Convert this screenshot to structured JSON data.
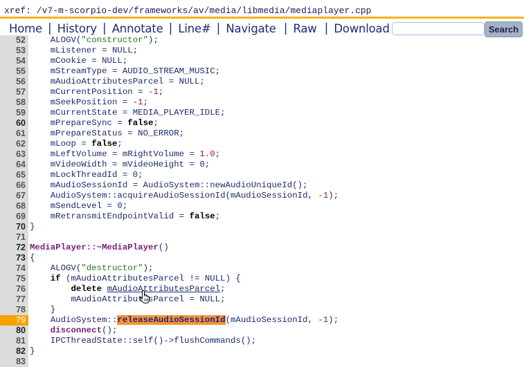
{
  "header": {
    "xref_path": "xref: /v7-m-scorpio-dev/frameworks/av/media/libmedia/mediaplayer.cpp",
    "accent_color": "#f5b21b"
  },
  "nav": {
    "items": [
      {
        "label": "Home"
      },
      {
        "label": "History"
      },
      {
        "label": "Annotate"
      },
      {
        "label": "Line#"
      },
      {
        "label": "Navigate"
      },
      {
        "label": "Raw"
      },
      {
        "label": "Download"
      }
    ],
    "separator": "|",
    "search": {
      "value": "",
      "placeholder": "",
      "button_label": "Search"
    }
  },
  "code": {
    "highlight_line": 79,
    "highlight_color": "#f5a300",
    "lines": [
      {
        "n": "52",
        "tokens": [
          {
            "t": "    ALOGV(",
            "c": ""
          },
          {
            "t": "\"constructor\"",
            "c": "str"
          },
          {
            "t": ");",
            "c": ""
          }
        ]
      },
      {
        "n": "53",
        "tokens": [
          {
            "t": "    mListener = NULL;",
            "c": ""
          }
        ]
      },
      {
        "n": "54",
        "tokens": [
          {
            "t": "    mCookie = NULL;",
            "c": ""
          }
        ]
      },
      {
        "n": "55",
        "tokens": [
          {
            "t": "    mStreamType = AUDIO_STREAM_MUSIC;",
            "c": ""
          }
        ]
      },
      {
        "n": "56",
        "tokens": [
          {
            "t": "    mAudioAttributesParcel = NULL;",
            "c": ""
          }
        ]
      },
      {
        "n": "57",
        "tokens": [
          {
            "t": "    mCurrentPosition = -",
            "c": ""
          },
          {
            "t": "1",
            "c": "num"
          },
          {
            "t": ";",
            "c": ""
          }
        ]
      },
      {
        "n": "58",
        "tokens": [
          {
            "t": "    mSeekPosition = -",
            "c": ""
          },
          {
            "t": "1",
            "c": "num"
          },
          {
            "t": ";",
            "c": ""
          }
        ]
      },
      {
        "n": "59",
        "tokens": [
          {
            "t": "    mCurrentState = MEDIA_PLAYER_IDLE;",
            "c": ""
          }
        ]
      },
      {
        "n": "60",
        "dark": true,
        "tokens": [
          {
            "t": "    mPrepareSync = ",
            "c": ""
          },
          {
            "t": "false",
            "c": "kw"
          },
          {
            "t": ";",
            "c": ""
          }
        ]
      },
      {
        "n": "61",
        "tokens": [
          {
            "t": "    mPrepareStatus = NO_ERROR;",
            "c": ""
          }
        ]
      },
      {
        "n": "62",
        "tokens": [
          {
            "t": "    mLoop = ",
            "c": ""
          },
          {
            "t": "false",
            "c": "kw"
          },
          {
            "t": ";",
            "c": ""
          }
        ]
      },
      {
        "n": "63",
        "tokens": [
          {
            "t": "    mLeftVolume = mRightVolume = ",
            "c": ""
          },
          {
            "t": "1.0",
            "c": "num"
          },
          {
            "t": ";",
            "c": ""
          }
        ]
      },
      {
        "n": "64",
        "tokens": [
          {
            "t": "    mVideoWidth = mVideoHeight = 0;",
            "c": ""
          }
        ]
      },
      {
        "n": "65",
        "tokens": [
          {
            "t": "    mLockThreadId = 0;",
            "c": ""
          }
        ]
      },
      {
        "n": "66",
        "tokens": [
          {
            "t": "    mAudioSessionId = AudioSystem::newAudioUniqueId();",
            "c": ""
          }
        ]
      },
      {
        "n": "67",
        "tokens": [
          {
            "t": "    AudioSystem::acquireAudioSessionId(mAudioSessionId, -",
            "c": ""
          },
          {
            "t": "1",
            "c": "num"
          },
          {
            "t": ");",
            "c": ""
          }
        ]
      },
      {
        "n": "68",
        "tokens": [
          {
            "t": "    mSendLevel = 0;",
            "c": ""
          }
        ]
      },
      {
        "n": "69",
        "tokens": [
          {
            "t": "    mRetransmitEndpointValid = ",
            "c": ""
          },
          {
            "t": "false",
            "c": "kw"
          },
          {
            "t": ";",
            "c": ""
          }
        ]
      },
      {
        "n": "70",
        "dark": true,
        "tokens": [
          {
            "t": "}",
            "c": ""
          }
        ]
      },
      {
        "n": "71",
        "tokens": []
      },
      {
        "n": "72",
        "dark": true,
        "tokens": [
          {
            "t": "MediaPlayer::~MediaPlayer",
            "c": "fn"
          },
          {
            "t": "()",
            "c": ""
          }
        ]
      },
      {
        "n": "73",
        "dark": true,
        "tokens": [
          {
            "t": "{",
            "c": ""
          }
        ]
      },
      {
        "n": "74",
        "tokens": [
          {
            "t": "    ALOGV(",
            "c": ""
          },
          {
            "t": "\"destructor\"",
            "c": "str"
          },
          {
            "t": ");",
            "c": ""
          }
        ]
      },
      {
        "n": "75",
        "tokens": [
          {
            "t": "    ",
            "c": ""
          },
          {
            "t": "if",
            "c": "kw"
          },
          {
            "t": " (mAudioAttributesParcel != NULL) {",
            "c": ""
          }
        ]
      },
      {
        "n": "76",
        "tokens": [
          {
            "t": "        ",
            "c": ""
          },
          {
            "t": "delete",
            "c": "kw"
          },
          {
            "t": " ",
            "c": ""
          },
          {
            "t": "mAudioAttributesParcel",
            "c": "link-u"
          },
          {
            "t": ";",
            "c": ""
          }
        ]
      },
      {
        "n": "77",
        "tokens": [
          {
            "t": "        mAudioAttributesParcel = NULL;",
            "c": ""
          }
        ]
      },
      {
        "n": "78",
        "tokens": [
          {
            "t": "    }",
            "c": ""
          }
        ]
      },
      {
        "n": "79",
        "hl": true,
        "tokens": [
          {
            "t": "    AudioSystem::",
            "c": ""
          },
          {
            "t": "releaseAudioSessionId",
            "c": "hit"
          },
          {
            "t": "(mAudioSessionId, -",
            "c": ""
          },
          {
            "t": "1",
            "c": "num"
          },
          {
            "t": ");",
            "c": ""
          }
        ]
      },
      {
        "n": "80",
        "dark": true,
        "tokens": [
          {
            "t": "    ",
            "c": ""
          },
          {
            "t": "disconnect",
            "c": "fn"
          },
          {
            "t": "();",
            "c": ""
          }
        ]
      },
      {
        "n": "81",
        "tokens": [
          {
            "t": "    IPCThreadState::self()->flushCommands();",
            "c": ""
          }
        ]
      },
      {
        "n": "82",
        "dark": true,
        "tokens": [
          {
            "t": "}",
            "c": ""
          }
        ]
      },
      {
        "n": "83",
        "tokens": []
      }
    ]
  }
}
